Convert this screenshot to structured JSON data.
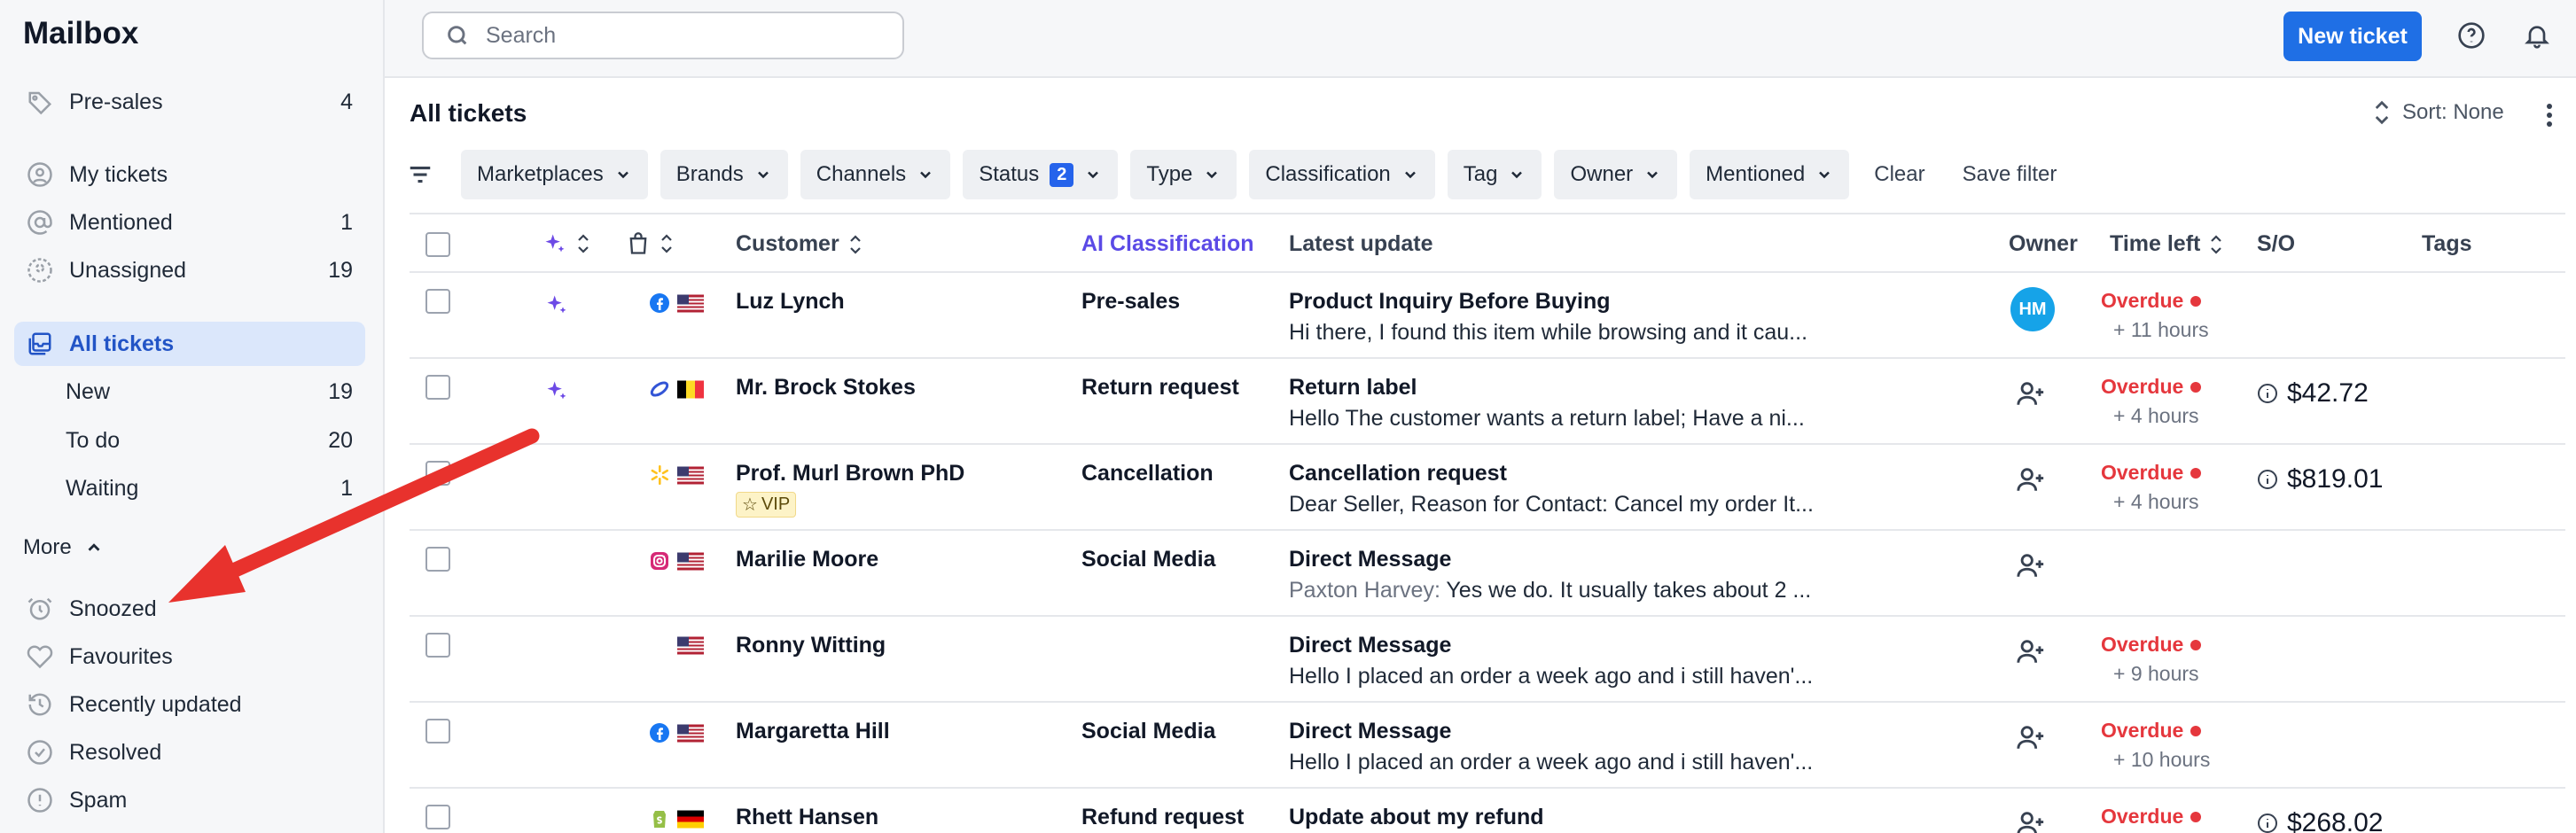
{
  "sidebar": {
    "title": "Mailbox",
    "items": [
      {
        "label": "Pre-sales",
        "count": "4",
        "icon": "tag-icon"
      },
      {
        "label": "My tickets",
        "count": "",
        "icon": "user-icon"
      },
      {
        "label": "Mentioned",
        "count": "1",
        "icon": "at-icon"
      },
      {
        "label": "Unassigned",
        "count": "19",
        "icon": "user-dashed-icon"
      },
      {
        "label": "All tickets",
        "count": "",
        "icon": "inbox-stack-icon"
      }
    ],
    "sub_items": [
      {
        "label": "New",
        "count": "19"
      },
      {
        "label": "To do",
        "count": "20"
      },
      {
        "label": "Waiting",
        "count": "1"
      }
    ],
    "more_label": "More",
    "more_items": [
      {
        "label": "Snoozed",
        "icon": "alarm-clock-icon"
      },
      {
        "label": "Favourites",
        "icon": "heart-icon"
      },
      {
        "label": "Recently updated",
        "icon": "history-icon"
      },
      {
        "label": "Resolved",
        "icon": "check-circle-icon"
      },
      {
        "label": "Spam",
        "icon": "alert-circle-icon"
      }
    ]
  },
  "topbar": {
    "search_placeholder": "Search",
    "new_ticket_label": "New ticket"
  },
  "main": {
    "title": "All tickets",
    "sort_label": "Sort: None",
    "filters": [
      "Marketplaces",
      "Brands",
      "Channels",
      "Status",
      "Type",
      "Classification",
      "Tag",
      "Owner",
      "Mentioned"
    ],
    "status_badge": "2",
    "clear_label": "Clear",
    "save_filter_label": "Save filter"
  },
  "table": {
    "headers": {
      "customer": "Customer",
      "ai_classification": "AI Classification",
      "latest_update": "Latest update",
      "owner": "Owner",
      "time_left": "Time left",
      "so": "S/O",
      "tags": "Tags"
    },
    "rows": [
      {
        "ai": true,
        "channel": "facebook",
        "flag": "us",
        "customer": "Luz Lynch",
        "vip": "",
        "classification": "Pre-sales",
        "update_title": "Product Inquiry Before Buying",
        "update_author": "",
        "update_body": "Hi there, I found this item while browsing and it cau...",
        "owner": "HM",
        "overdue": "Overdue",
        "extra": "+ 11 hours",
        "so": ""
      },
      {
        "ai": true,
        "channel": "ebay",
        "flag": "be",
        "customer": "Mr. Brock Stokes",
        "vip": "",
        "classification": "Return request",
        "update_title": "Return label",
        "update_author": "",
        "update_body": "Hello The customer wants a return label; Have a ni...",
        "owner": "",
        "overdue": "Overdue",
        "extra": "+ 4 hours",
        "so": "$42.72"
      },
      {
        "ai": false,
        "channel": "walmart",
        "flag": "us",
        "customer": "Prof. Murl Brown PhD",
        "vip": "VIP",
        "classification": "Cancellation",
        "update_title": "Cancellation request",
        "update_author": "",
        "update_body": "Dear Seller, Reason for Contact: Cancel my order It...",
        "owner": "",
        "overdue": "Overdue",
        "extra": "+ 4 hours",
        "so": "$819.01"
      },
      {
        "ai": false,
        "channel": "instagram",
        "flag": "us",
        "customer": "Marilie Moore",
        "vip": "",
        "classification": "Social Media",
        "update_title": "Direct Message",
        "update_author": "Paxton Harvey:",
        "update_body": "Yes we do. It usually takes about 2 ...",
        "owner": "",
        "overdue": "",
        "extra": "",
        "so": ""
      },
      {
        "ai": false,
        "channel": "",
        "flag": "us",
        "customer": "Ronny Witting",
        "vip": "",
        "classification": "",
        "update_title": "Direct Message",
        "update_author": "",
        "update_body": "Hello I placed an order a week ago and i still haven'...",
        "owner": "",
        "overdue": "Overdue",
        "extra": "+ 9 hours",
        "so": ""
      },
      {
        "ai": false,
        "channel": "facebook",
        "flag": "us",
        "customer": "Margaretta Hill",
        "vip": "",
        "classification": "Social Media",
        "update_title": "Direct Message",
        "update_author": "",
        "update_body": "Hello I placed an order a week ago and i still haven'...",
        "owner": "",
        "overdue": "Overdue",
        "extra": "+ 10 hours",
        "so": ""
      },
      {
        "ai": false,
        "channel": "shopify",
        "flag": "de",
        "customer": "Rhett Hansen",
        "vip": "",
        "classification": "Refund request",
        "update_title": "Update about my refund",
        "update_author": "",
        "update_body": "",
        "owner": "",
        "overdue": "Overdue",
        "extra": "",
        "so": "$268.02"
      }
    ]
  },
  "colors": {
    "accent": "#1f6fe5",
    "overdue": "#e5373d",
    "ai": "#5b4ae6",
    "annotation_arrow": "#e8322d"
  }
}
